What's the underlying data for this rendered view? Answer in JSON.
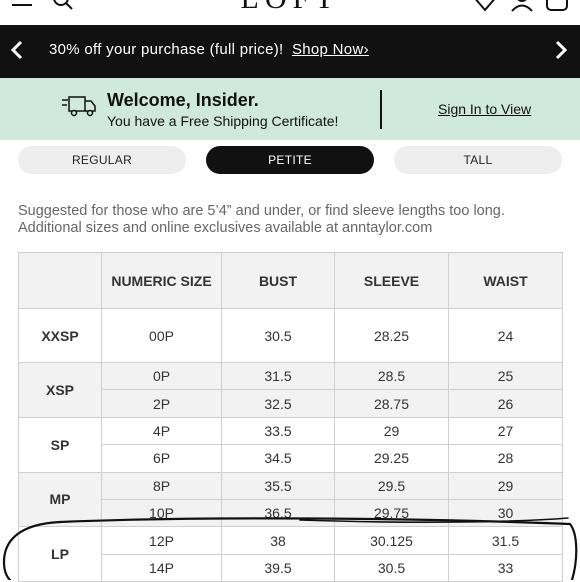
{
  "nav": {
    "logo": "LOFT",
    "icons": [
      "menu-icon",
      "search-icon",
      "heart-icon",
      "user-icon",
      "bag-icon"
    ]
  },
  "promo": {
    "text": "30% off your purchase (full price)!",
    "link": "Shop Now›"
  },
  "insider": {
    "title": "Welcome, Insider.",
    "subtitle": "You have a Free Shipping Certificate!",
    "signin": "Sign In to View",
    "background": "#cfe9de"
  },
  "tabs": [
    {
      "label": "REGULAR",
      "active": false
    },
    {
      "label": "PETITE",
      "active": true
    },
    {
      "label": "TALL",
      "active": false
    }
  ],
  "description": "Suggested for those who are 5’4” and under, or find sleeve lengths too long. Additional sizes and online exclusives available at anntaylor.com",
  "table": {
    "headers": [
      "",
      "NUMERIC SIZE",
      "BUST",
      "SLEEVE",
      "WAIST"
    ],
    "groups": [
      {
        "label": "XXSP",
        "rows": [
          [
            "00P",
            "30.5",
            "28.25",
            "24"
          ]
        ]
      },
      {
        "label": "XSP",
        "rows": [
          [
            "0P",
            "31.5",
            "28.5",
            "25"
          ],
          [
            "2P",
            "32.5",
            "28.75",
            "26"
          ]
        ]
      },
      {
        "label": "SP",
        "rows": [
          [
            "4P",
            "33.5",
            "29",
            "27"
          ],
          [
            "6P",
            "34.5",
            "29.25",
            "28"
          ]
        ]
      },
      {
        "label": "MP",
        "rows": [
          [
            "8P",
            "35.5",
            "29.5",
            "29"
          ],
          [
            "10P",
            "36.5",
            "29.75",
            "30"
          ]
        ]
      },
      {
        "label": "LP",
        "rows": [
          [
            "12P",
            "38",
            "30.125",
            "31.5"
          ],
          [
            "14P",
            "39.5",
            "30.5",
            "33"
          ]
        ]
      }
    ]
  }
}
